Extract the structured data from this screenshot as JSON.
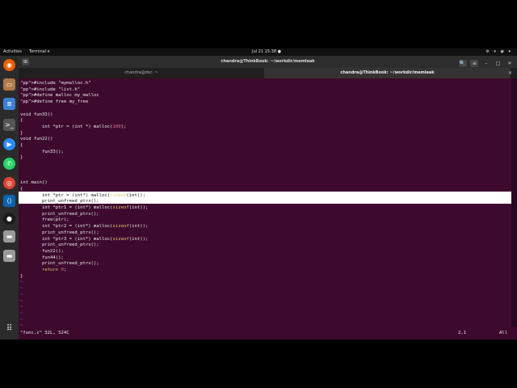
{
  "topbar": {
    "activities": "Activities",
    "app": "Terminal ▾",
    "clock": "Jul 21  15:38  ●",
    "system": "⚙ ▾ ◉ ▾"
  },
  "dock": {
    "items": [
      "firefox-icon",
      "files-icon",
      "docs-icon",
      "terminal-icon",
      "zoom-icon",
      "whatsapp-icon",
      "chrome-icon",
      "vscode-icon",
      "obs-icon",
      "drive-icon",
      "drive2-icon",
      "apps-grid-icon"
    ]
  },
  "window": {
    "title": "chandra@ThinkBook: ~/workdir/memleak",
    "new_tab": "⊞",
    "search": "🔍",
    "menu": "≡",
    "minimize": "–",
    "maximize": "□",
    "close": "✕"
  },
  "tabs": [
    {
      "label": "chandra@dsc: ~"
    },
    {
      "label": "chandra@ThinkBook: ~/workdir/memleak"
    }
  ],
  "editor": {
    "lines": [
      [
        "#include \"mymalloc.h\""
      ],
      [
        "#include \"list.h\""
      ],
      [
        "#define malloc my_malloc"
      ],
      [
        "#define free my_free"
      ],
      [
        ""
      ],
      [
        "void fun33()"
      ],
      [
        "{"
      ],
      [
        "        int *ptr = (int *) malloc(100);"
      ],
      [
        "}"
      ],
      [
        "void fun22()"
      ],
      [
        "{"
      ],
      [
        "        fun33();"
      ],
      [
        "}"
      ],
      [
        ""
      ],
      [
        ""
      ],
      [
        ""
      ],
      [
        "int main()"
      ],
      [
        "{"
      ],
      [
        "        int *ptr = (int*) malloc(sizeof(int));"
      ],
      [
        "        print_unfreed_ptrs();"
      ],
      [
        "        int *ptr1 = (int*) malloc(sizeof(int));"
      ],
      [
        "        print_unfreed_ptrs();"
      ],
      [
        "        free(ptr);"
      ],
      [
        "        int *ptr2 = (int*) malloc(sizeof(int));"
      ],
      [
        "        print_unfreed_ptrs();"
      ],
      [
        "        int *ptr3 = (int*) malloc(sizeof(int));"
      ],
      [
        "        print_unfreed_ptrs();"
      ],
      [
        "        fun22();"
      ],
      [
        "        fun44();"
      ],
      [
        "        print_unfreed_ptrs();"
      ],
      [
        "        return 0;"
      ],
      [
        "}"
      ]
    ],
    "tilde_lines": 8
  },
  "status": {
    "file": "\"func.c\" 32L, 524C",
    "position": "2,1",
    "scroll": "All"
  }
}
